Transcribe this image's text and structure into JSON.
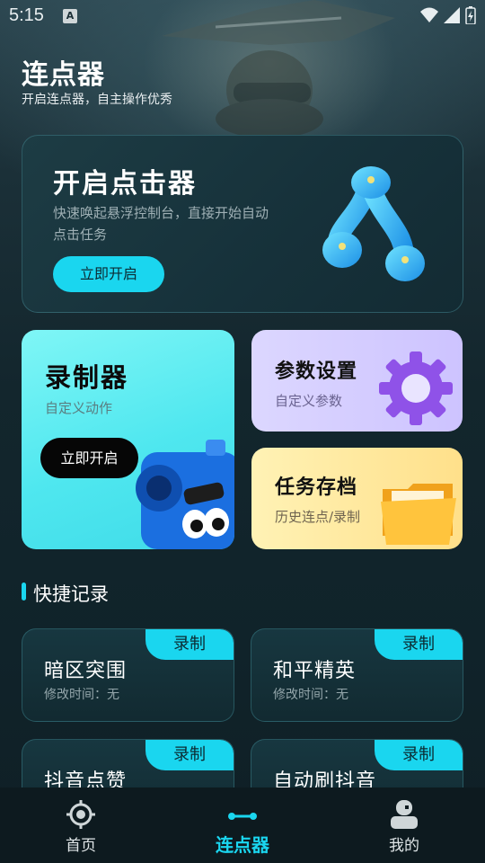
{
  "status_bar": {
    "time": "5:15",
    "notification_icon": "A"
  },
  "header": {
    "title": "连点器",
    "subtitle": "开启连点器，自主操作优秀"
  },
  "hero": {
    "title": "开启点击器",
    "description": "快速唤起悬浮控制台，直接开始自动点击任务",
    "button": "立即开启"
  },
  "cards": {
    "recorder": {
      "title": "录制器",
      "subtitle": "自定义动作",
      "button": "立即开启"
    },
    "params": {
      "title": "参数设置",
      "subtitle": "自定义参数"
    },
    "archive": {
      "title": "任务存档",
      "subtitle": "历史连点/录制"
    }
  },
  "quick": {
    "title": "快捷记录",
    "items": [
      {
        "tag": "录制",
        "title": "暗区突围",
        "meta": "修改时间：无"
      },
      {
        "tag": "录制",
        "title": "和平精英",
        "meta": "修改时间：无"
      },
      {
        "tag": "录制",
        "title": "抖音点赞"
      },
      {
        "tag": "录制",
        "title": "自动刷抖音"
      }
    ]
  },
  "nav": {
    "tabs": [
      {
        "label": "首页",
        "icon": "crosshair-icon"
      },
      {
        "label": "连点器",
        "icon": "link-dots-icon",
        "active": true
      },
      {
        "label": "我的",
        "icon": "user-icon"
      }
    ]
  },
  "colors": {
    "accent": "#1ad6ef",
    "background": "#10232a",
    "nav_bg": "#0d1a1f"
  }
}
